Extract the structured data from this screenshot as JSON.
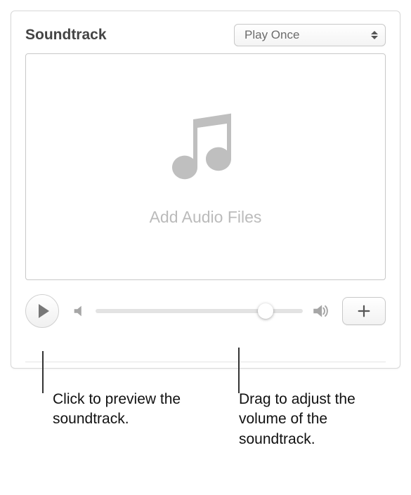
{
  "section": {
    "title": "Soundtrack",
    "repeatMode": "Play Once"
  },
  "dropzone": {
    "placeholder": "Add Audio Files"
  },
  "controls": {
    "volumePercent": 82
  },
  "callouts": {
    "playPreview": "Click to preview the soundtrack.",
    "volumeSlider": "Drag to adjust the volume of the soundtrack."
  }
}
